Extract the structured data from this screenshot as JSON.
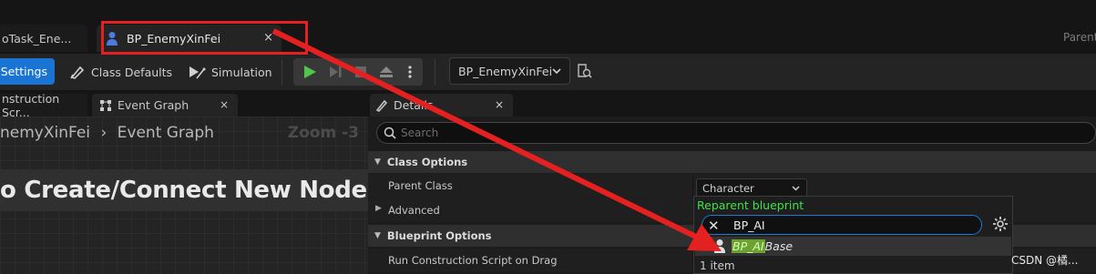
{
  "tabs": {
    "documents": [
      {
        "label": "oTask_Ene...",
        "active": false
      },
      {
        "label": "BP_EnemyXinFei",
        "active": true
      }
    ],
    "close_glyph": "×",
    "parent_text": "Parent"
  },
  "toolbar": {
    "settings_label": "s Settings",
    "class_defaults_label": "Class Defaults",
    "simulation_label": "Simulation",
    "debug_object": "BP_EnemyXinFei",
    "icons": [
      "class-defaults-icon",
      "simulation-icon",
      "play-icon",
      "step-icon",
      "stop-icon",
      "eject-icon",
      "more-options-icon",
      "debug-find-icon"
    ]
  },
  "graph": {
    "tabs": [
      "nstruction Scr...",
      "Event Graph"
    ],
    "breadcrumb_parent": "nemyXinFei",
    "breadcrumb_current": "Event Graph",
    "zoom": "Zoom -3",
    "hint": "o Create/Connect New Nodes."
  },
  "details": {
    "tab_label": "Details",
    "search_placeholder": "Search",
    "sections": [
      {
        "title": "Class Options",
        "rows": [
          {
            "label": "Parent Class",
            "value": "Character"
          },
          {
            "label": "Advanced"
          }
        ]
      },
      {
        "title": "Blueprint Options",
        "rows": [
          {
            "label": "Run Construction Script on Drag"
          }
        ]
      }
    ]
  },
  "reparent_popup": {
    "title": "Reparent blueprint",
    "search_value": "BP_AI",
    "result_match": "BP_AI",
    "result_rest": "Base",
    "count": "1 item"
  },
  "watermark": "CSDN @橘...",
  "annotation_color": "#e52020"
}
